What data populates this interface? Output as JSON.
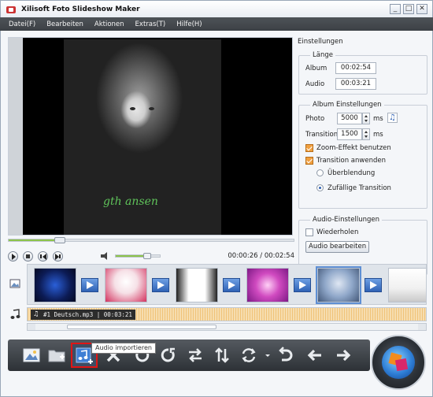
{
  "window": {
    "title": "Xilisoft Foto Slideshow Maker",
    "btn_min": "_",
    "btn_max": "□",
    "btn_close": "✕"
  },
  "menu": {
    "items": [
      "Datei(F)",
      "Bearbeiten",
      "Aktionen",
      "Extras(T)",
      "Hilfe(H)"
    ]
  },
  "preview": {
    "watermark": "gth ansen"
  },
  "player": {
    "time": "00:00:26 / 00:02:54",
    "progress": 0.18,
    "volume": 0.72
  },
  "settings": {
    "title": "Einstellungen",
    "laenge": {
      "legend": "Länge",
      "album_label": "Album",
      "album_value": "00:02:54",
      "audio_label": "Audio",
      "audio_value": "00:03:21"
    },
    "album": {
      "legend": "Album Einstellungen",
      "photo_label": "Photo",
      "photo_value": "5000",
      "photo_unit": "ms",
      "transition_label": "Transition",
      "transition_value": "1500",
      "transition_unit": "ms",
      "zoom_label": "Zoom-Effekt benutzen",
      "zoom_checked": true,
      "apply_label": "Transition anwenden",
      "apply_checked": true,
      "radio1_label": "Überblendung",
      "radio2_label": "Zufällige Transition",
      "radio_selected": 2
    },
    "audio": {
      "legend": "Audio-Einstellungen",
      "repeat_label": "Wiederholen",
      "repeat_checked": false,
      "edit_button": "Audio bearbeiten"
    }
  },
  "timeline": {
    "audio_clip": "#1 Deutsch.mp3 | 00:03:21"
  },
  "toolbar": {
    "tooltip": "Audio importieren",
    "active_button": "Audio importieren",
    "icons": [
      "add-photo-icon",
      "add-folder-icon",
      "import-audio-icon",
      "delete-icon",
      "rotate-left-icon",
      "rotate-right-icon",
      "swap-icon",
      "sort-icon",
      "transition-icon",
      "undo-icon",
      "move-left-icon",
      "move-right-icon"
    ]
  },
  "colors": {
    "accent_red": "#e01515",
    "progress_green": "#8cc34b",
    "transition_blue": "#2f62b5",
    "menubar": "#45494e"
  }
}
